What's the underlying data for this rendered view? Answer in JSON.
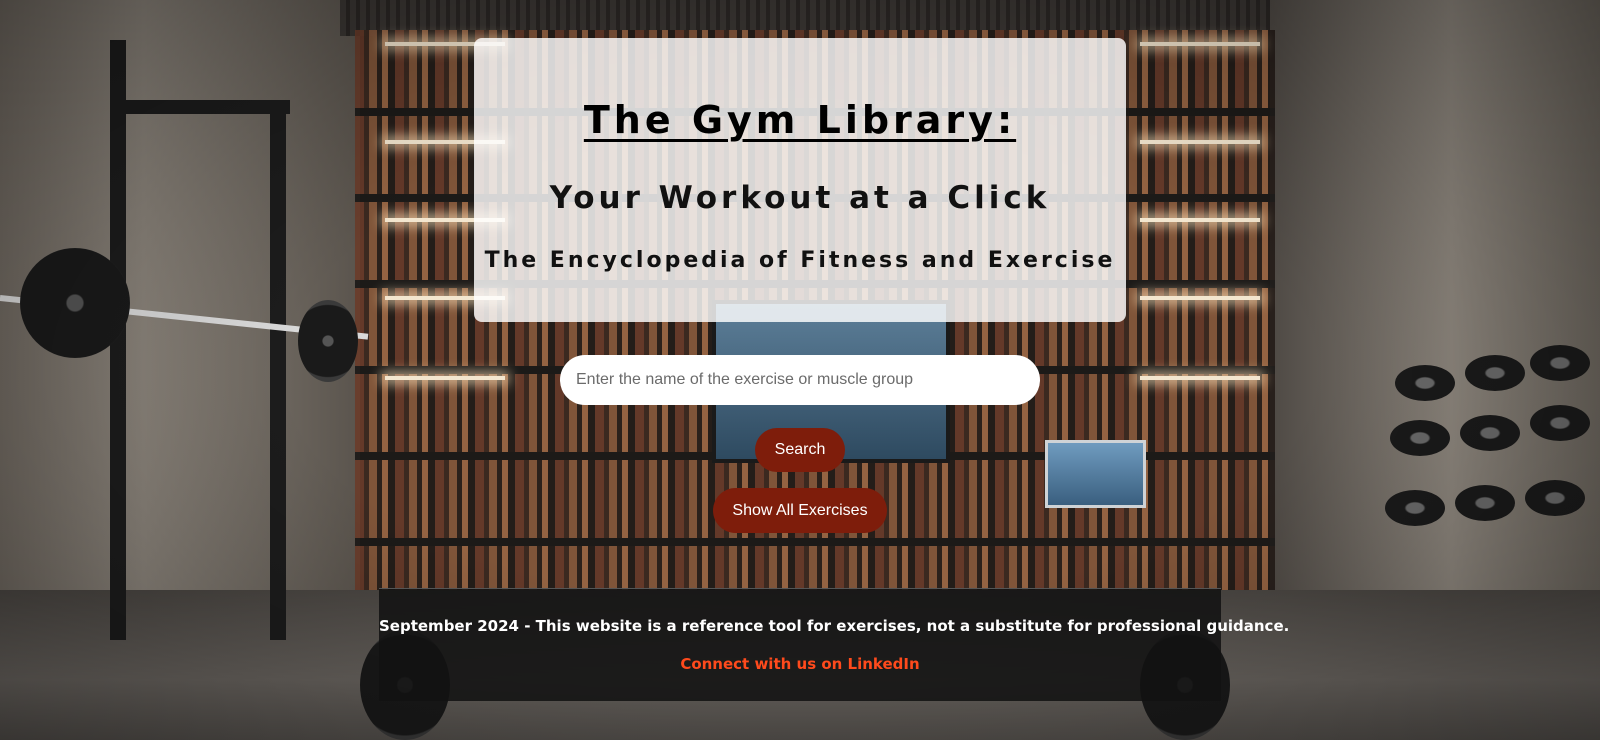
{
  "hero": {
    "title": "The Gym Library:",
    "tagline": "Your Workout at a Click",
    "subtitle": "The Encyclopedia of Fitness and Exercise"
  },
  "search": {
    "placeholder": "Enter the name of the exercise or muscle group",
    "value": "",
    "button_label": "Search"
  },
  "actions": {
    "show_all_label": "Show All Exercises"
  },
  "footer": {
    "note": "September 2024 - This website is a reference tool for exercises, not a substitute for professional guidance.",
    "link_label": "Connect with us on LinkedIn"
  },
  "colors": {
    "button_bg": "#7e1d0b",
    "link": "#ff4a1c",
    "card_bg": "rgba(255,255,255,0.82)",
    "footer_bg": "rgba(18,18,18,0.88)"
  }
}
